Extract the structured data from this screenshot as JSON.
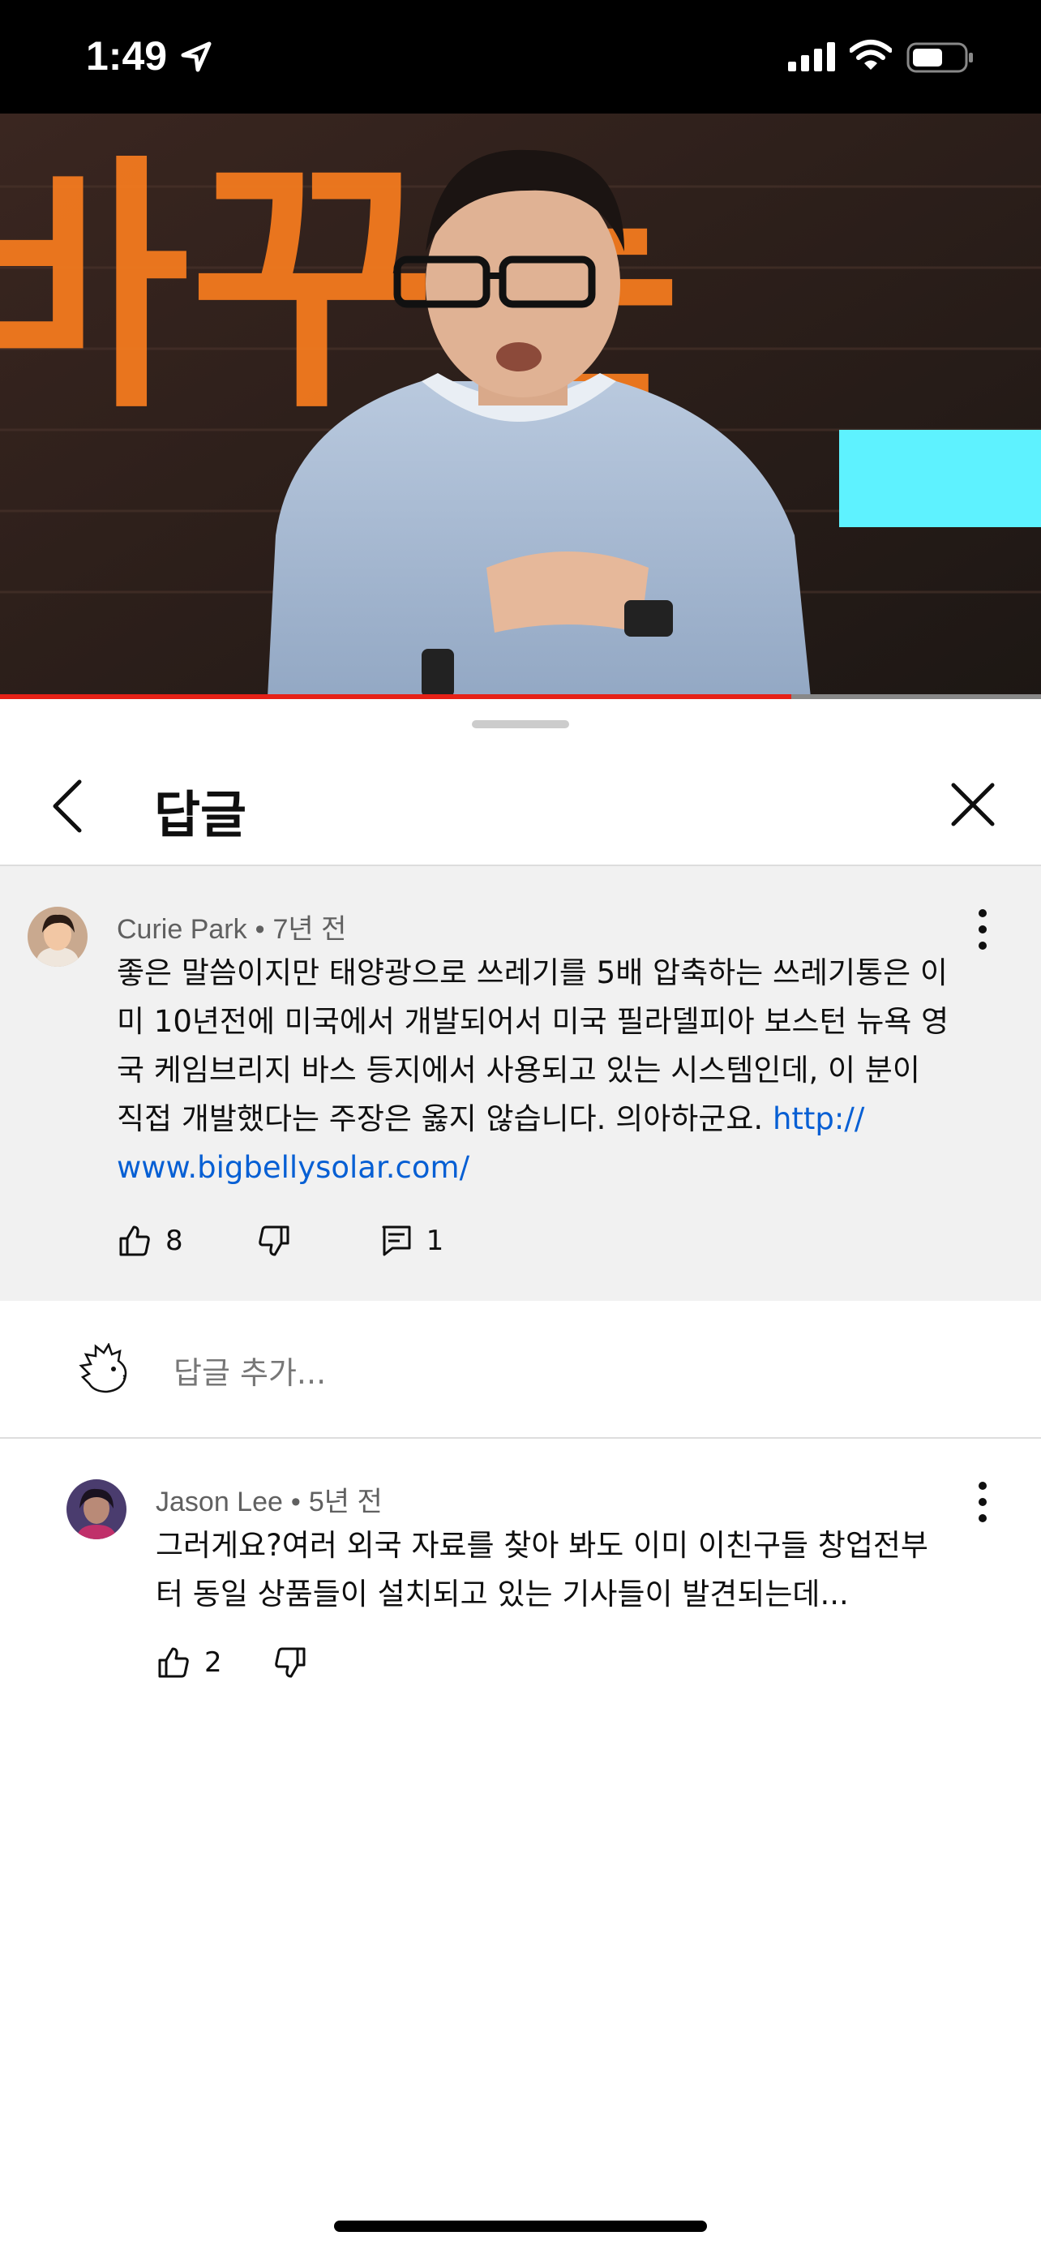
{
  "status_bar": {
    "time": "1:49"
  },
  "video": {
    "stage_text": "바꾸는",
    "progress": 0.76
  },
  "panel": {
    "title": "답글"
  },
  "parent_comment": {
    "author": "Curie Park",
    "time": "7년 전",
    "text": "좋은 말씀이지만 태양광으로 쓰레기를 5배 압축하는 쓰레기통은 이\n미 10년전에 미국에서 개발되어서 미국 필라델피아 보스턴 뉴욕  영\n국 케임브리지 바스 등지에서 사용되고 있는 시스템인데, 이 분이\n직접 개발했다는 주장은 옳지 않습니다. 의아하군요. ",
    "link": "http://\nwww.bigbellysolar.com/",
    "likes": "8",
    "replies": "1"
  },
  "reply_input": {
    "placeholder": "답글 추가..."
  },
  "replies": [
    {
      "author": "Jason Lee",
      "time": "5년 전",
      "text": "그러게요?여러 외국 자료를 찾아 봐도 이미 이친구들 창업전부\n터 동일 상품들이 설치되고 있는 기사들이 발견되는데...",
      "likes": "2"
    }
  ],
  "colors": {
    "progress": "#e62117",
    "link": "#065fd4",
    "parent_bg": "#f1f1f1"
  }
}
